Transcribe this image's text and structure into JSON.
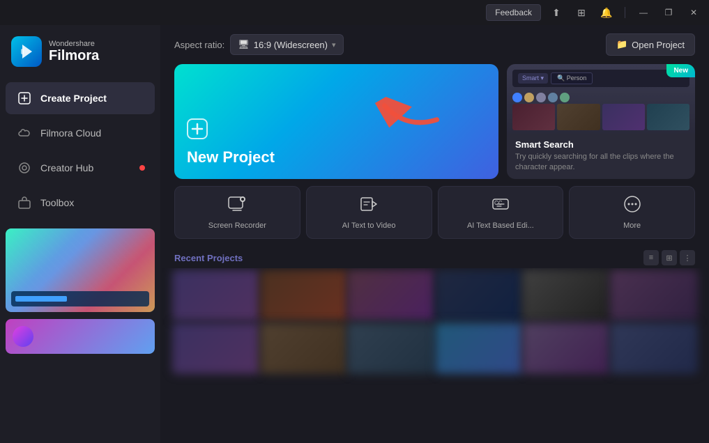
{
  "titleBar": {
    "feedback": "Feedback",
    "minimize": "—",
    "restore": "❐",
    "close": "✕"
  },
  "logo": {
    "topText": "Wondershare",
    "bottomText": "Filmora"
  },
  "sidebar": {
    "items": [
      {
        "id": "create-project",
        "label": "Create Project",
        "icon": "⊞",
        "active": true,
        "dot": false
      },
      {
        "id": "filmora-cloud",
        "label": "Filmora Cloud",
        "icon": "☁",
        "active": false,
        "dot": false
      },
      {
        "id": "creator-hub",
        "label": "Creator Hub",
        "icon": "◎",
        "active": false,
        "dot": true
      },
      {
        "id": "toolbox",
        "label": "Toolbox",
        "icon": "⊡",
        "active": false,
        "dot": false
      }
    ]
  },
  "topBar": {
    "aspectLabel": "Aspect ratio:",
    "aspectValue": "16:9 (Widescreen)",
    "openProject": "Open Project"
  },
  "newProject": {
    "title": "New Project",
    "plusIcon": "⊕"
  },
  "featureCard": {
    "badge": "New",
    "title": "Smart Search",
    "description": "Try quickly searching for all the clips where the character appear.",
    "previewSearch": "Person",
    "previewFilter": "Smart ▾",
    "dots": [
      false,
      true,
      false
    ]
  },
  "quickActions": [
    {
      "id": "screen-recorder",
      "icon": "⧉",
      "label": "Screen Recorder"
    },
    {
      "id": "ai-text-to-video",
      "icon": "⬛",
      "label": "AI Text to Video"
    },
    {
      "id": "ai-text-based-edit",
      "icon": "㏄",
      "label": "AI Text Based Edi..."
    },
    {
      "id": "more",
      "icon": "⊕",
      "label": "More"
    }
  ],
  "recents": {
    "title": "Recent Projects",
    "viewIcons": [
      "≡",
      "⊞",
      "⋮⋮"
    ]
  },
  "videoGrid": {
    "row1": [
      "vt-1",
      "vt-2",
      "vt-3",
      "vt-4",
      "vt-5",
      "vt-6"
    ],
    "row2": [
      "vt-b1",
      "vt-b2",
      "vt-b3",
      "vt-b4",
      "vt-b5",
      "vt-b6"
    ]
  }
}
